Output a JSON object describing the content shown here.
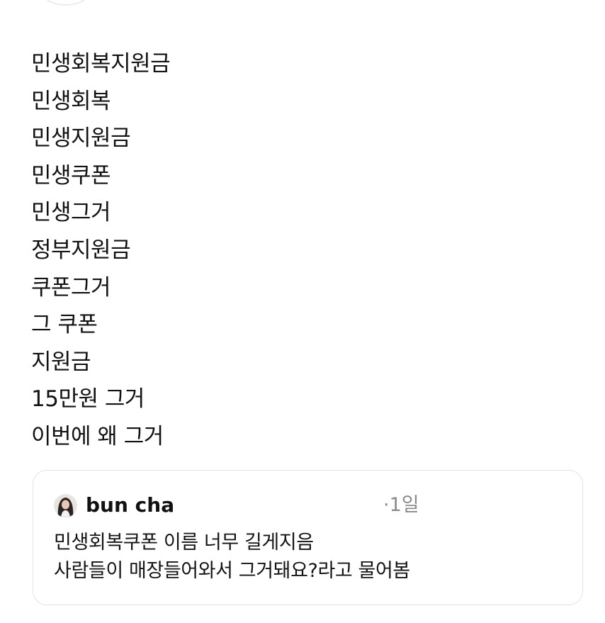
{
  "post": {
    "lines": [
      "민생회복지원금",
      "민생회복",
      "민생지원금",
      "민생쿠폰",
      "민생그거",
      "정부지원금",
      "쿠폰그거",
      "그 쿠폰",
      "지원금",
      "15만원 그거",
      "이번에 왜 그거"
    ]
  },
  "quote": {
    "author": "bun cha",
    "time": "·1일",
    "lines": [
      "민생회복쿠폰 이름 너무 길게지음",
      "사람들이 매장들어와서 그거돼요?라고 물어봄"
    ]
  }
}
